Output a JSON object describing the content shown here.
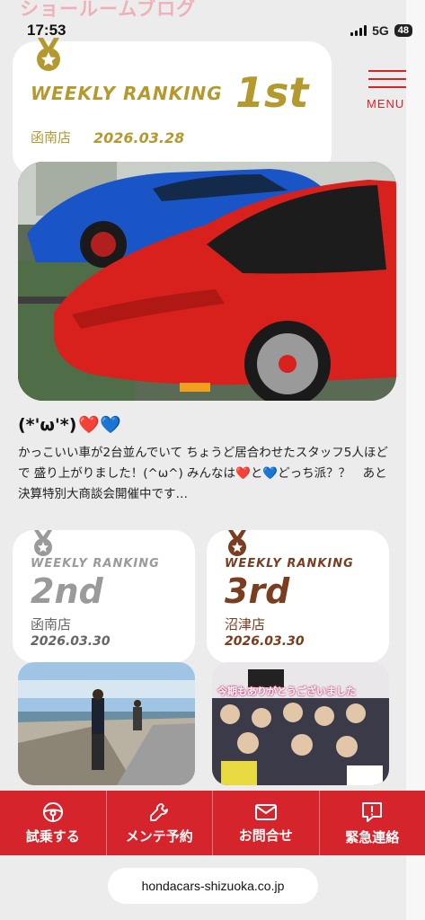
{
  "header": {
    "faded_title": "ショールームブログ"
  },
  "status_bar": {
    "time": "17:53",
    "network": "5G",
    "battery": "48"
  },
  "menu": {
    "label": "MENU"
  },
  "ranking_1": {
    "label": "WEEKLY RANKING",
    "rank": "1st",
    "shop": "函南店",
    "date": "2026.03.28",
    "color": "#b49a2e"
  },
  "post": {
    "title": "(*'ω'*)",
    "title_emoji": "❤️💙",
    "body": "かっこいい車が2台並んでいて ちょうど居合わせたスタッフ5人ほどで 盛り上がりました！(^ω^) みんなは❤️と💙どっち派？？　あと決算特別大商談会開催中です…"
  },
  "ranking_2": {
    "label": "WEEKLY RANKING",
    "rank": "2nd",
    "shop": "函南店",
    "date": "2026.03.30",
    "color": "#9a9a9a"
  },
  "ranking_3": {
    "label": "WEEKLY RANKING",
    "rank": "3rd",
    "shop": "沼津店",
    "date": "2026.03.30",
    "color": "#7a3d1f"
  },
  "thumb_3": {
    "caption": "今期もありがとうございました"
  },
  "bottom_nav": [
    {
      "label": "試乗する",
      "icon": "steering-wheel-icon"
    },
    {
      "label": "メンテ予約",
      "icon": "wrench-icon"
    },
    {
      "label": "お問合せ",
      "icon": "mail-icon"
    },
    {
      "label": "緊急連絡",
      "icon": "alert-chat-icon"
    }
  ],
  "browser": {
    "url": "hondacars-shizuoka.co.jp"
  },
  "colors": {
    "brand_red": "#d5242c",
    "gold": "#b49a2e",
    "silver": "#9a9a9a",
    "bronze": "#7a3d1f"
  }
}
